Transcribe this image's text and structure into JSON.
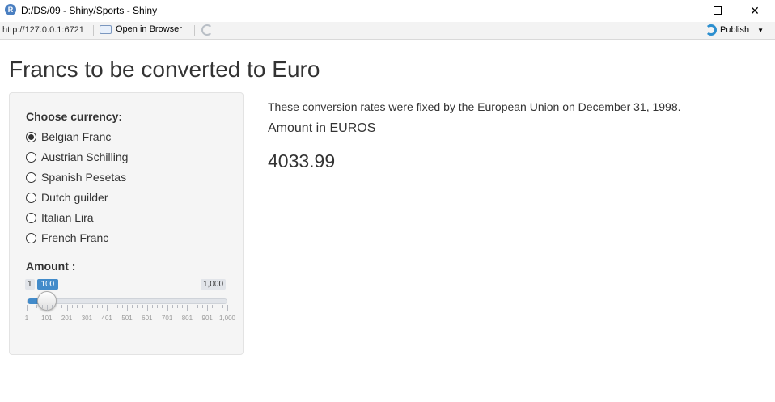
{
  "window": {
    "title": "D:/DS/09 - Shiny/Sports - Shiny",
    "app_icon": "R",
    "minimize_icon": "minimize-icon",
    "maximize_icon": "maximize-icon",
    "close_icon": "close-icon",
    "close_glyph": "✕"
  },
  "toolbar": {
    "url": "http://127.0.0.1:6721",
    "open_in_browser": "Open in Browser",
    "publish": "Publish",
    "publish_arrow": "▼",
    "accent": "#2c8fcf"
  },
  "app": {
    "title": "Francs to be converted to Euro",
    "sidebar": {
      "currency_label": "Choose currency:",
      "currencies": [
        "Belgian Franc",
        "Austrian Schilling",
        "Spanish Pesetas",
        "Dutch guilder",
        "Italian Lira",
        "French Franc"
      ],
      "selected_currency": "Belgian Franc",
      "amount_label": "Amount :",
      "slider": {
        "min_label": "1",
        "max_label": "1,000",
        "value_label": "100",
        "value": 100,
        "min": 1,
        "max": 1000,
        "grid_labels": [
          "1",
          "101",
          "201",
          "301",
          "401",
          "501",
          "601",
          "701",
          "801",
          "901",
          "1,000"
        ],
        "fill_color": "#428bca"
      }
    },
    "main": {
      "note": "These conversion rates were fixed by the European Union on December 31, 1998.",
      "heading": "Amount in EUROS",
      "value": "4033.99"
    }
  }
}
